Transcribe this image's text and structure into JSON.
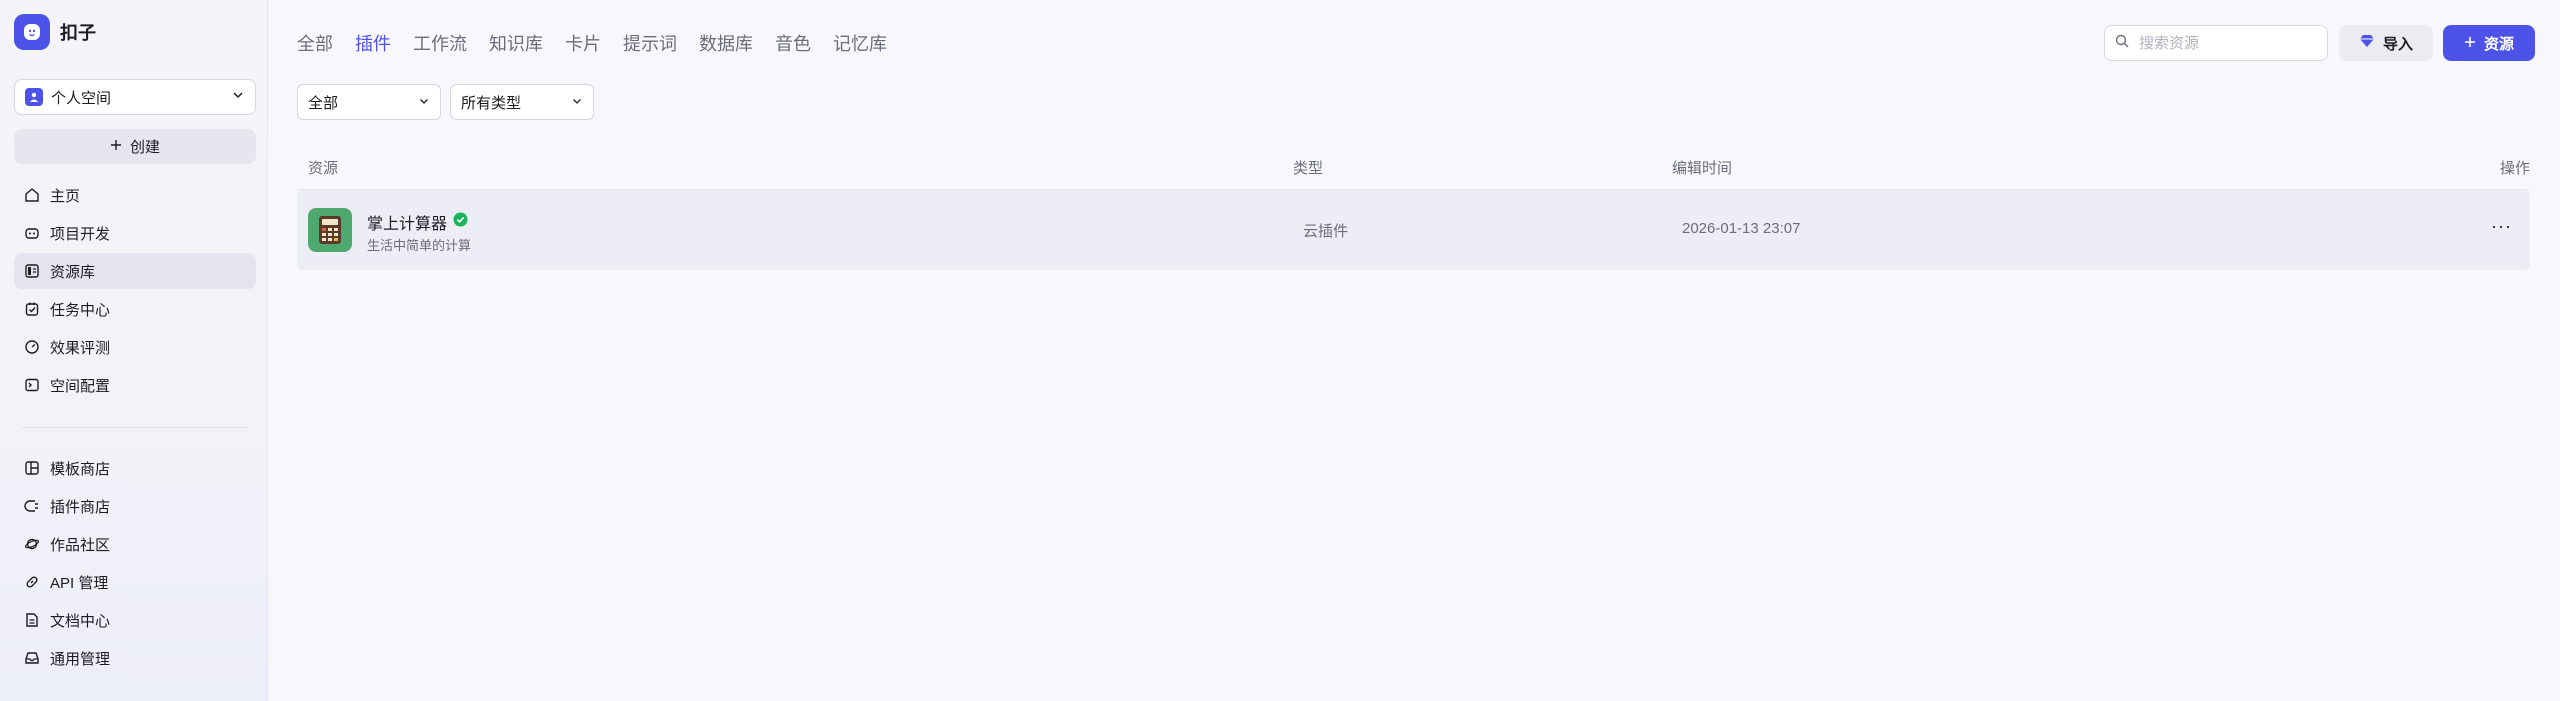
{
  "app": {
    "name": "扣子"
  },
  "sidebar": {
    "space_label": "个人空间",
    "create_label": "创建",
    "main_items": [
      {
        "label": "主页",
        "icon": "home-icon"
      },
      {
        "label": "项目开发",
        "icon": "robot-icon"
      },
      {
        "label": "资源库",
        "icon": "library-icon"
      },
      {
        "label": "任务中心",
        "icon": "task-icon"
      },
      {
        "label": "效果评测",
        "icon": "gauge-icon"
      },
      {
        "label": "空间配置",
        "icon": "terminal-icon"
      }
    ],
    "explore_items": [
      {
        "label": "模板商店",
        "icon": "template-icon"
      },
      {
        "label": "插件商店",
        "icon": "plugin-icon"
      },
      {
        "label": "作品社区",
        "icon": "planet-icon"
      },
      {
        "label": "API 管理",
        "icon": "link-icon"
      },
      {
        "label": "文档中心",
        "icon": "document-icon"
      },
      {
        "label": "通用管理",
        "icon": "inbox-icon"
      }
    ]
  },
  "tabs": [
    "全部",
    "插件",
    "工作流",
    "知识库",
    "卡片",
    "提示词",
    "数据库",
    "音色",
    "记忆库"
  ],
  "active_tab": "插件",
  "search": {
    "placeholder": "搜索资源"
  },
  "toolbar": {
    "import_label": "导入",
    "add_resource_label": "资源"
  },
  "filters": {
    "scope": "全部",
    "type": "所有类型"
  },
  "table": {
    "headers": {
      "resource": "资源",
      "type": "类型",
      "edited": "编辑时间",
      "actions": "操作"
    },
    "rows": [
      {
        "name": "掌上计算器",
        "description": "生活中简单的计算",
        "type": "云插件",
        "edited_time": "2026-01-13 23:07"
      }
    ]
  },
  "colors": {
    "accent": "#4d53e8",
    "verified": "#19b35a",
    "plugin_thumb": "#4fa86f"
  }
}
